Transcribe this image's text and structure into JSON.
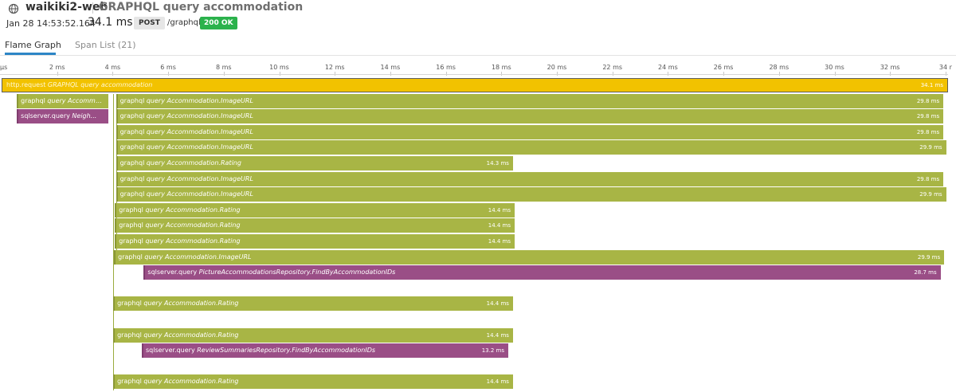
{
  "header": {
    "service": "waikiki2-web",
    "resource": "GRAPHQL query accommodation",
    "date": "Jan 28 14:53:52.164",
    "duration": "34.1 ms",
    "method": "POST",
    "path": "/graphql",
    "status": "200 OK"
  },
  "tabs": [
    {
      "label": "Flame Graph",
      "active": true
    },
    {
      "label": "Span List (21)",
      "active": false
    }
  ],
  "axis": {
    "unit": "ms",
    "max_ms": 34,
    "ticks": [
      "µs",
      "2 ms",
      "4 ms",
      "6 ms",
      "8 ms",
      "10 ms",
      "12 ms",
      "14 ms",
      "16 ms",
      "18 ms",
      "20 ms",
      "22 ms",
      "24 ms",
      "26 ms",
      "28 ms",
      "30 ms",
      "32 ms",
      "34 r"
    ]
  },
  "colors": {
    "graphql": "#a8b545",
    "graphql_edge": "#8a9735",
    "sqlserver": "#9a4e86",
    "sqlserver_edge": "#7f3c6e",
    "http": "#f2c200",
    "tab_accent": "#2d86c6",
    "status_ok": "#2bb24c"
  },
  "spans": [
    {
      "kind": "http",
      "op": "http.request",
      "resource": "GRAPHQL query accommodation",
      "duration": "34.1 ms",
      "start_ms": 0.0,
      "dur_ms": 34.1,
      "row": 0
    },
    {
      "kind": "graphql",
      "op": "graphql",
      "resource": "query Accommo...",
      "duration": "",
      "start_ms": 0.55,
      "dur_ms": 3.3,
      "row": 1
    },
    {
      "kind": "sqlserver",
      "op": "sqlserver.query",
      "resource": "Neigh...",
      "duration": "",
      "start_ms": 0.55,
      "dur_ms": 3.3,
      "row": 2
    },
    {
      "kind": "graphql",
      "op": "graphql",
      "resource": "query Accommodation.ImageURL",
      "duration": "29.8 ms",
      "start_ms": 4.12,
      "dur_ms": 29.8,
      "row": 1
    },
    {
      "kind": "graphql",
      "op": "graphql",
      "resource": "query Accommodation.ImageURL",
      "duration": "29.8 ms",
      "start_ms": 4.12,
      "dur_ms": 29.8,
      "row": 2
    },
    {
      "kind": "graphql",
      "op": "graphql",
      "resource": "query Accommodation.ImageURL",
      "duration": "29.8 ms",
      "start_ms": 4.12,
      "dur_ms": 29.8,
      "row": 3
    },
    {
      "kind": "graphql",
      "op": "graphql",
      "resource": "query Accommodation.ImageURL",
      "duration": "29.9 ms",
      "start_ms": 4.12,
      "dur_ms": 29.9,
      "row": 4
    },
    {
      "kind": "graphql",
      "op": "graphql",
      "resource": "query Accommodation.Rating",
      "duration": "14.3 ms",
      "start_ms": 4.12,
      "dur_ms": 14.3,
      "row": 5
    },
    {
      "kind": "graphql",
      "op": "graphql",
      "resource": "query Accommodation.ImageURL",
      "duration": "29.8 ms",
      "start_ms": 4.12,
      "dur_ms": 29.8,
      "row": 6
    },
    {
      "kind": "graphql",
      "op": "graphql",
      "resource": "query Accommodation.ImageURL",
      "duration": "29.9 ms",
      "start_ms": 4.12,
      "dur_ms": 29.9,
      "row": 7
    },
    {
      "kind": "graphql",
      "op": "graphql",
      "resource": "query Accommodation.Rating",
      "duration": "14.4 ms",
      "start_ms": 4.08,
      "dur_ms": 14.4,
      "row": 8
    },
    {
      "kind": "graphql",
      "op": "graphql",
      "resource": "query Accommodation.Rating",
      "duration": "14.4 ms",
      "start_ms": 4.08,
      "dur_ms": 14.4,
      "row": 9
    },
    {
      "kind": "graphql",
      "op": "graphql",
      "resource": "query Accommodation.Rating",
      "duration": "14.4 ms",
      "start_ms": 4.08,
      "dur_ms": 14.4,
      "row": 10
    },
    {
      "kind": "graphql",
      "op": "graphql",
      "resource": "query Accommodation.ImageURL",
      "duration": "29.9 ms",
      "start_ms": 4.05,
      "dur_ms": 29.9,
      "row": 11
    },
    {
      "kind": "sqlserver",
      "op": "sqlserver.query",
      "resource": "PictureAccommodationsRepository.FindByAccommodationIDs",
      "duration": "28.7 ms",
      "start_ms": 5.12,
      "dur_ms": 28.7,
      "row": 12
    },
    {
      "kind": "graphql",
      "op": "graphql",
      "resource": "query Accommodation.Rating",
      "duration": "14.4 ms",
      "start_ms": 4.02,
      "dur_ms": 14.4,
      "row": 14
    },
    {
      "kind": "graphql",
      "op": "graphql",
      "resource": "query Accommodation.Rating",
      "duration": "14.4 ms",
      "start_ms": 4.02,
      "dur_ms": 14.4,
      "row": 16
    },
    {
      "kind": "sqlserver",
      "op": "sqlserver.query",
      "resource": "ReviewSummariesRepository.FindByAccommodationIDs",
      "duration": "13.2 ms",
      "start_ms": 5.05,
      "dur_ms": 13.2,
      "row": 17
    },
    {
      "kind": "graphql",
      "op": "graphql",
      "resource": "query Accommodation.Rating",
      "duration": "14.4 ms",
      "start_ms": 4.02,
      "dur_ms": 14.4,
      "row": 19
    }
  ]
}
